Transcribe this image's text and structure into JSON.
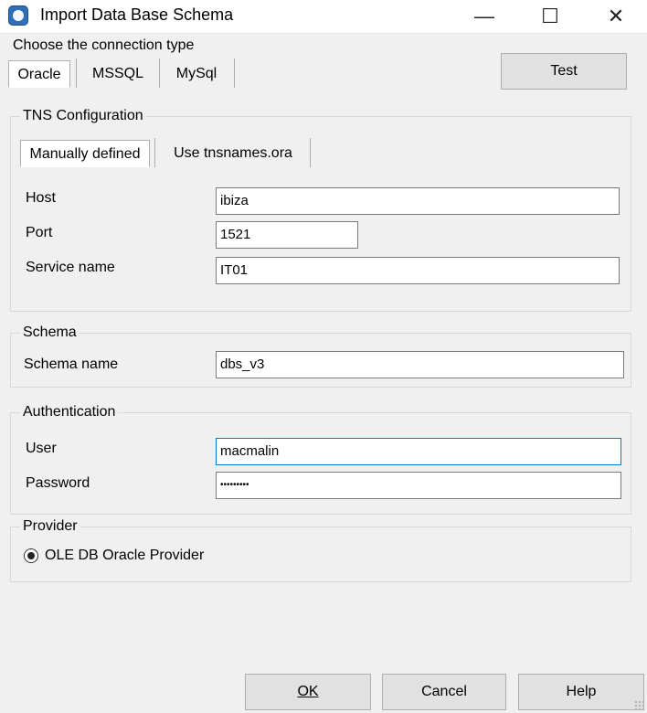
{
  "window": {
    "title": "Import Data Base Schema",
    "controls": {
      "minimize": "—",
      "maximize": "☐",
      "close": "✕"
    }
  },
  "connection": {
    "group_label": "Choose the connection type",
    "tabs": [
      "Oracle",
      "MSSQL",
      "MySql"
    ],
    "active_tab": "Oracle",
    "test_button": "Test"
  },
  "tns": {
    "group_label": "TNS Configuration",
    "tabs": [
      "Manually defined",
      "Use tnsnames.ora"
    ],
    "active_tab": "Manually defined",
    "host_label": "Host",
    "host_value": "ibiza",
    "port_label": "Port",
    "port_value": "1521",
    "service_label": "Service name",
    "service_value": "IT01"
  },
  "schema": {
    "group_label": "Schema",
    "name_label": "Schema name",
    "name_value": "dbs_v3"
  },
  "auth": {
    "group_label": "Authentication",
    "user_label": "User",
    "user_value": "macmalin",
    "password_label": "Password",
    "password_value": "•••••••••"
  },
  "provider": {
    "group_label": "Provider",
    "option_label": "OLE DB Oracle Provider",
    "selected": true
  },
  "footer": {
    "ok_label": "OK",
    "cancel_label": "Cancel",
    "help_label": "Help"
  },
  "colors": {
    "focus": "#0078d7",
    "window_bg": "#f0f0f0",
    "button_bg": "#e1e1e1"
  }
}
